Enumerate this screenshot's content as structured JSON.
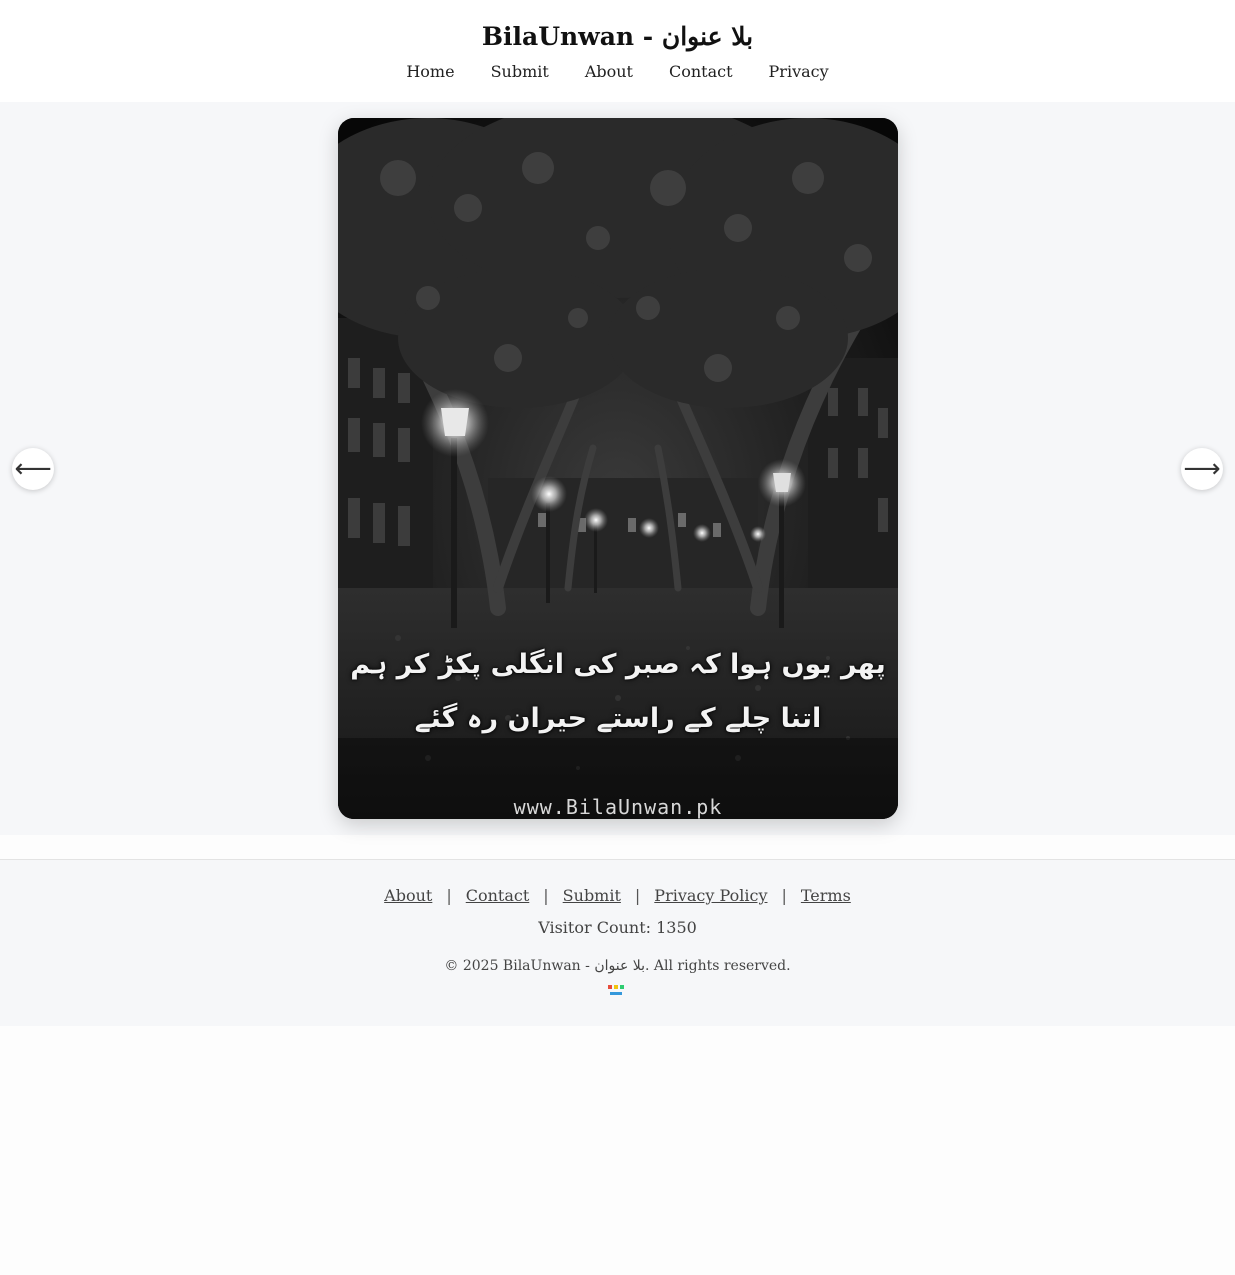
{
  "header": {
    "title": "BilaUnwan - بلا عنوان",
    "nav": [
      "Home",
      "Submit",
      "About",
      "Contact",
      "Privacy"
    ]
  },
  "slide": {
    "poem_lines": [
      "پھر یوں ہوا کہ صبر کی انگلی پکڑ کر ہم",
      "اتنا چلے کے راستے حیران رہ گئے"
    ],
    "watermark": "www.BilaUnwan.pk",
    "prev_icon": "arrow-left-icon",
    "next_icon": "arrow-right-icon",
    "prev_glyph": "⟵",
    "next_glyph": "⟶"
  },
  "footer": {
    "links": [
      "About",
      "Contact",
      "Submit",
      "Privacy Policy",
      "Terms"
    ],
    "separator": "|",
    "visitor_count": "Visitor Count: 1350",
    "copyright": "© 2025 BilaUnwan - بلا عنوان. All rights reserved."
  },
  "colors": {
    "page_bg": "#fdfdfd",
    "hero_bg": "#f6f7f9",
    "footer_bg": "#f6f7f9"
  }
}
